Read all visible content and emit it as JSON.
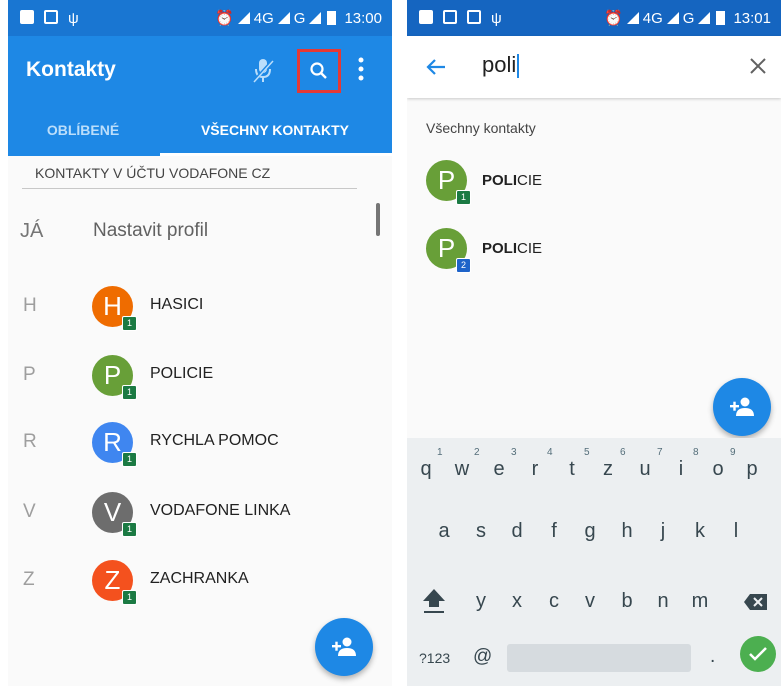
{
  "left": {
    "status": {
      "network": "4G",
      "network2": "G",
      "time": "13:00"
    },
    "app_title": "Kontakty",
    "tabs": [
      {
        "label": "OBLÍBENÉ"
      },
      {
        "label": "VŠECHNY KONTAKTY"
      }
    ],
    "section_header": "KONTAKTY V ÚČTU VODAFONE CZ",
    "me": {
      "letter": "JÁ",
      "label": "Nastavit profil"
    },
    "contacts": [
      {
        "letter": "H",
        "initial": "H",
        "name": "HASICI",
        "badge": "1",
        "color": "#ef6c00"
      },
      {
        "letter": "P",
        "initial": "P",
        "name": "POLICIE",
        "badge": "1",
        "color": "#689f38"
      },
      {
        "letter": "R",
        "initial": "R",
        "name": "RYCHLA POMOC",
        "badge": "1",
        "color": "#3f86f0"
      },
      {
        "letter": "V",
        "initial": "V",
        "name": "VODAFONE LINKA",
        "badge": "1",
        "color": "#6d6d6d"
      },
      {
        "letter": "Z",
        "initial": "Z",
        "name": "ZACHRANKA",
        "badge": "1",
        "color": "#f4511e"
      }
    ]
  },
  "right": {
    "status": {
      "network": "4G",
      "network2": "G",
      "time": "13:01"
    },
    "search_query": "poli",
    "results_header": "Všechny kontakty",
    "results": [
      {
        "initial": "P",
        "match": "POLI",
        "rest": "CIE",
        "badge": "1",
        "badge_color": "#1b7a43",
        "color": "#689f38"
      },
      {
        "initial": "P",
        "match": "POLI",
        "rest": "CIE",
        "badge": "2",
        "badge_color": "#1e63c9",
        "color": "#689f38"
      }
    ],
    "keyboard": {
      "row1": [
        "q",
        "w",
        "e",
        "r",
        "t",
        "z",
        "u",
        "i",
        "o",
        "p"
      ],
      "row1_hints": [
        "1",
        "2",
        "3",
        "4",
        "5",
        "6",
        "7",
        "8",
        "9"
      ],
      "row2": [
        "a",
        "s",
        "d",
        "f",
        "g",
        "h",
        "j",
        "k",
        "l"
      ],
      "row3": [
        "y",
        "x",
        "c",
        "v",
        "b",
        "n",
        "m"
      ],
      "symbols_key": "?123",
      "at_key": "@",
      "period_key": "."
    }
  },
  "colors": {
    "primary": "#1e88e5",
    "status_dark": "#1976d2",
    "highlight_box": "#e53935",
    "done": "#4caf50"
  }
}
